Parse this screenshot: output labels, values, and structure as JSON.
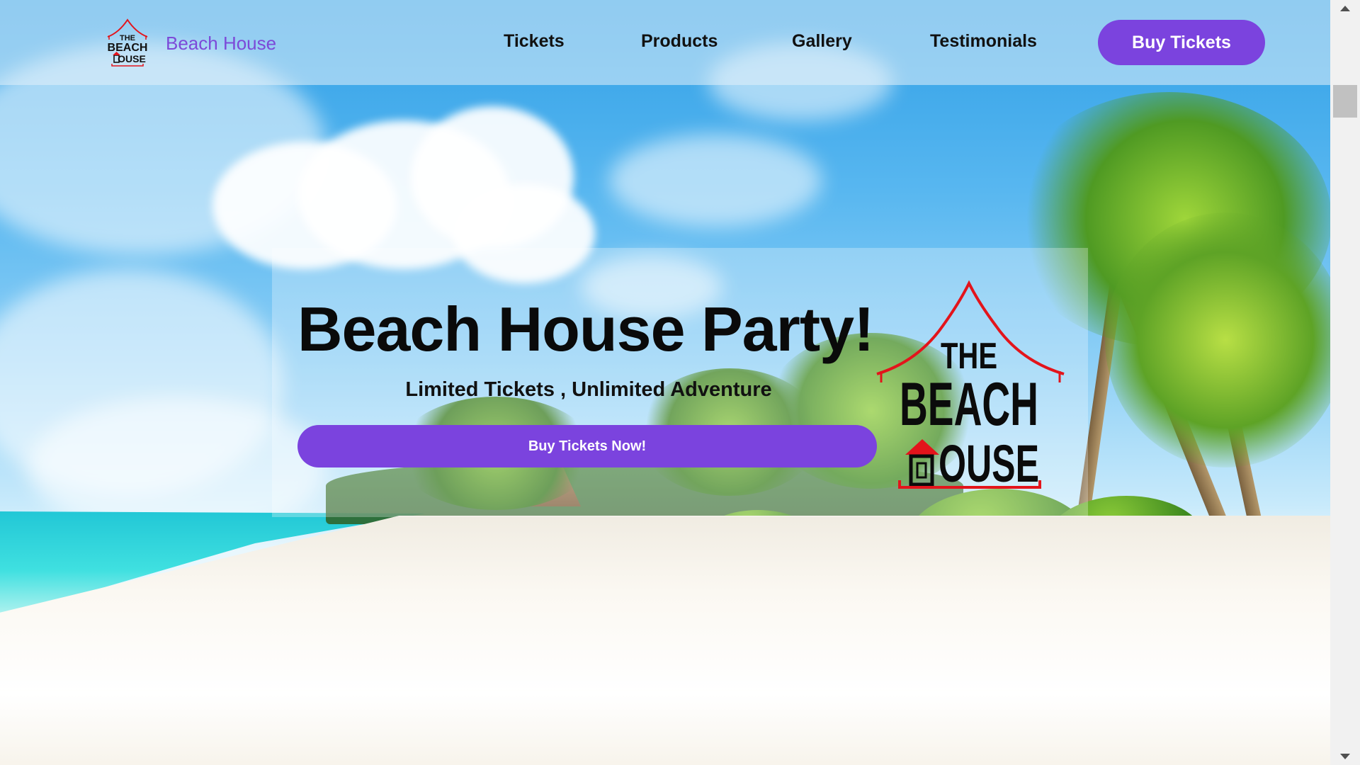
{
  "navbar": {
    "brand_name": "Beach House",
    "links": [
      {
        "label": "Tickets"
      },
      {
        "label": "Products"
      },
      {
        "label": "Gallery"
      },
      {
        "label": "Testimonials"
      }
    ],
    "cta_label": "Buy Tickets"
  },
  "logo": {
    "line1": "THE",
    "line2": "BEACH",
    "line3": "OUSE"
  },
  "hero": {
    "title": "Beach House Party!",
    "subtitle": "Limited Tickets , Unlimited Adventure",
    "button_label": "Buy Tickets Now!"
  },
  "colors": {
    "accent": "#7b43de",
    "brand_text": "#7c4ad8",
    "logo_red": "#e3141b"
  },
  "icons": [
    "beach-house-logo-icon",
    "scroll-up-arrow-icon",
    "scroll-down-arrow-icon"
  ]
}
